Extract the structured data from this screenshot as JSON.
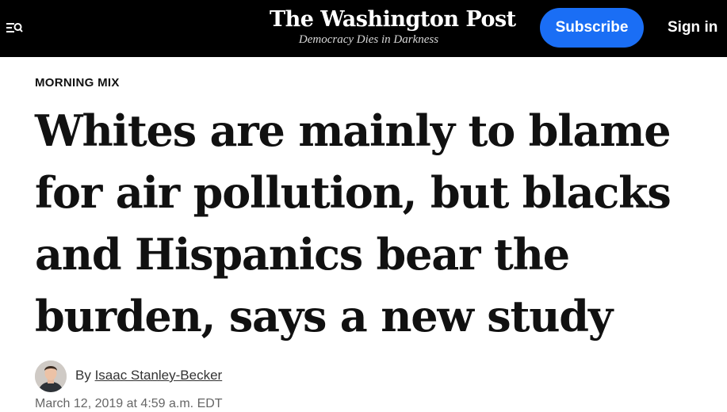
{
  "header": {
    "menu_icon": "menu-search-icon",
    "logo": "The Washington Post",
    "tagline": "Democracy Dies in Darkness",
    "subscribe_label": "Subscribe",
    "signin_label": "Sign in"
  },
  "article": {
    "kicker": "MORNING MIX",
    "headline": "Whites are mainly to blame for air pollution, but blacks and Hispanics bear the burden, says a new study",
    "byline_prefix": "By",
    "author": "Isaac Stanley-Becker",
    "avatar_icon": "author-avatar",
    "timestamp": "March 12, 2019 at 4:59 a.m. EDT"
  },
  "colors": {
    "header_bg": "#000000",
    "subscribe_bg": "#1a6ef5",
    "text": "#111111",
    "meta_text": "#666666"
  }
}
